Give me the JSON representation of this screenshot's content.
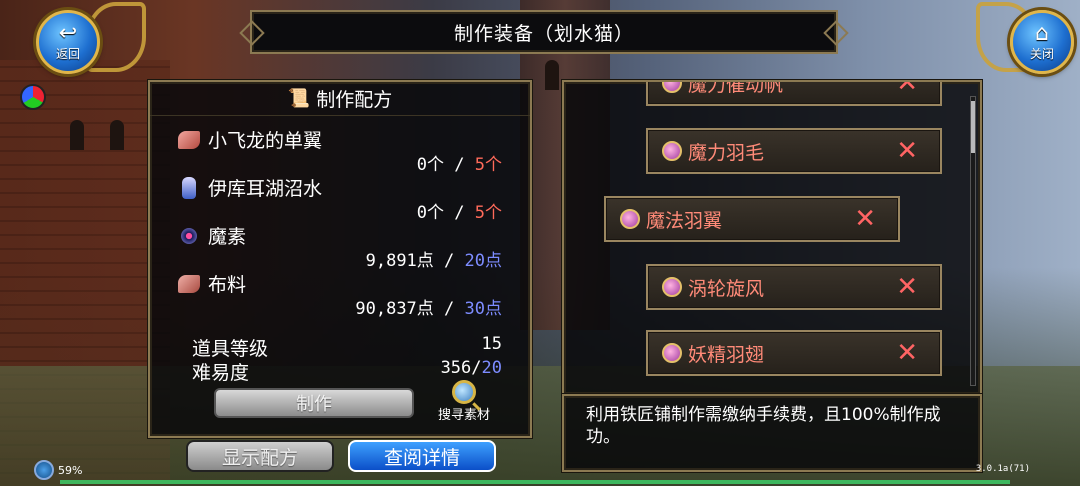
{
  "window": {
    "title": "制作装备（划水猫）"
  },
  "nav": {
    "back_label": "返回",
    "close_label": "关闭"
  },
  "recipe": {
    "header": "制作配方",
    "materials": [
      {
        "name": "小飞龙的单翼",
        "have": "0个",
        "sep": " / ",
        "need": "5个",
        "need_color": "#ff6a5a",
        "icon": "wing-feather-icon"
      },
      {
        "name": "伊库耳湖沼水",
        "have": "0个",
        "sep": " / ",
        "need": "5个",
        "need_color": "#ff6a5a",
        "icon": "water-flask-icon"
      },
      {
        "name": "魔素",
        "have": "9,891点",
        "sep": " / ",
        "need": "20点",
        "need_color": "#7d8cff",
        "icon": "mana-orb-icon"
      },
      {
        "name": "布料",
        "have": "90,837点",
        "sep": " / ",
        "need": "30点",
        "need_color": "#7d8cff",
        "icon": "cloth-icon"
      }
    ],
    "item_level_label": "道具等级",
    "item_level_value": "15",
    "difficulty_label": "难易度",
    "difficulty_have": "356/",
    "difficulty_need": "20",
    "make_button": "制作",
    "search_label": "搜寻素材"
  },
  "buttons": {
    "show_recipe": "显示配方",
    "view_detail": "查阅详情"
  },
  "list": {
    "items": [
      {
        "label": "魔力催动帆",
        "removable": true
      },
      {
        "label": "魔力羽毛",
        "removable": true
      },
      {
        "label": "魔法羽翼",
        "removable": true,
        "selected": true
      },
      {
        "label": "涡轮旋风",
        "removable": true
      },
      {
        "label": "妖精羽翅",
        "removable": true
      }
    ],
    "remove_glyph": "✕"
  },
  "description": "利用铁匠铺制作需缴纳手续费，且100%制作成功。",
  "status": {
    "battery": "59%",
    "version": "3.0.1a(71)"
  }
}
